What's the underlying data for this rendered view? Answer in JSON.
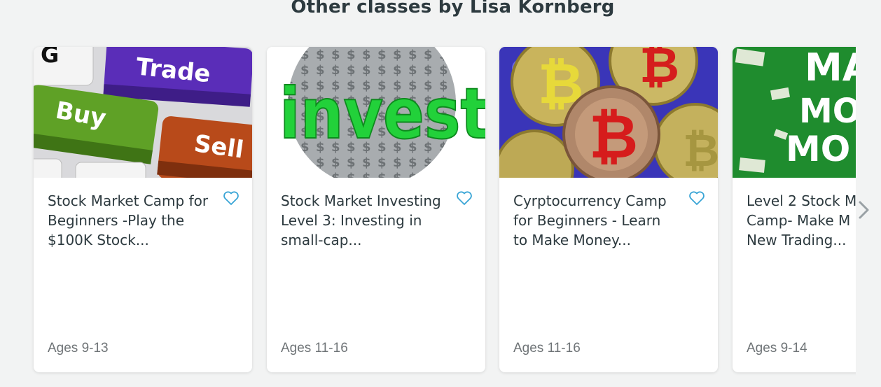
{
  "section": {
    "title": "Other classes by Lisa Kornberg"
  },
  "cards": [
    {
      "title": "Stock Market Camp for\nBeginners -Play the\n$100K Stock...",
      "ages": "Ages 9-13",
      "image": {
        "icon": "keyboard-keys-image",
        "labels": [
          "G",
          "Trade",
          "Buy",
          "Sell"
        ]
      }
    },
    {
      "title": "Stock Market Investing\nLevel 3: Investing in\nsmall-cap...",
      "ages": "Ages 11-16",
      "image": {
        "icon": "invest-dollar-sphere-image",
        "labels": [
          "invest"
        ]
      }
    },
    {
      "title": "Cyrptocurrency Camp\nfor Beginners - Learn\nto Make Money...",
      "ages": "Ages 11-16",
      "image": {
        "icon": "bitcoin-coins-image",
        "labels": []
      }
    },
    {
      "title": "Level 2 Stock M\nCamp- Make M\nNew Trading...",
      "ages": "Ages 9-14",
      "image": {
        "icon": "make-money-green-image",
        "labels": [
          "MA",
          "MO",
          "MO"
        ]
      }
    }
  ],
  "colors": {
    "background": "#f2f3f3",
    "heart": "#3aa5d6",
    "title_text": "#2d3a3f",
    "ages_text": "#6f7477"
  },
  "icons": {
    "favorite": "heart-outline-icon",
    "next": "chevron-right-icon"
  }
}
